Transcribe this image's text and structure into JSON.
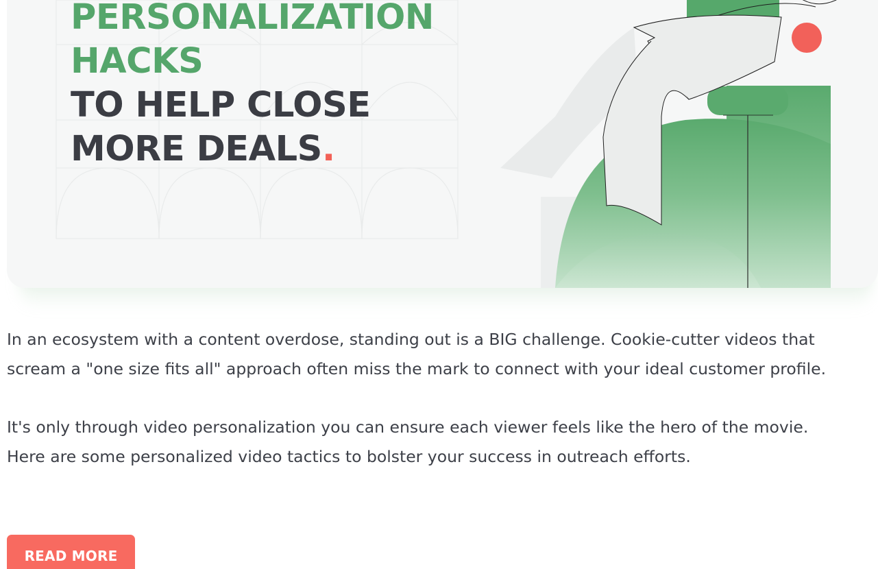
{
  "hero": {
    "headline_line1": "PERSONALIZATION",
    "headline_line2": "HACKS",
    "headline_line3": "TO HELP CLOSE",
    "headline_line4": "MORE DEALS",
    "headline_dot": ".",
    "colors": {
      "green": "#55a66b",
      "dark": "#3b3d44",
      "accent": "#f26157",
      "background": "#f6f7f7"
    },
    "illustration": "person-leaping-onto-green-shapes-illustration"
  },
  "article": {
    "paragraph1": "In an ecosystem with a content overdose, standing out is a BIG challenge. Cookie-cutter videos that scream a \"one size fits all\" approach often miss the mark to connect with your ideal customer profile.",
    "paragraph2": "It's only through video personalization you can ensure each viewer feels like the hero of the movie. Here are some personalized video tactics to bolster your success in outreach efforts."
  },
  "cta": {
    "read_more_label": "READ MORE",
    "color": "#f86a60"
  }
}
